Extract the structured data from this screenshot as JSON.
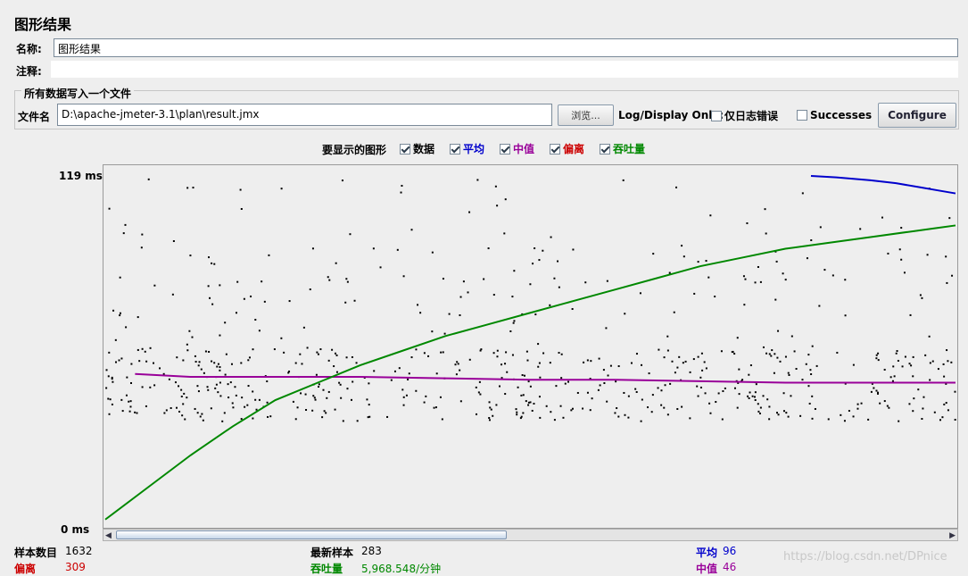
{
  "panel": {
    "title": "图形结果",
    "name_label": "名称:",
    "name_value": "图形结果",
    "comment_label": "注释:",
    "comment_value": ""
  },
  "file_group": {
    "legend": "所有数据写入一个文件",
    "file_label": "文件名",
    "file_value": "D:\\apache-jmeter-3.1\\plan\\result.jmx",
    "browse_button": "浏览...",
    "log_display_label": "Log/Display Only:",
    "errors_only_label": "仅日志错误",
    "successes_label": "Successes",
    "configure_button": "Configure"
  },
  "graph_options": {
    "label": "要显示的图形",
    "items": [
      {
        "label": "数据",
        "checked": true,
        "color": "#000000"
      },
      {
        "label": "平均",
        "checked": true,
        "color": "#0000cc"
      },
      {
        "label": "中值",
        "checked": true,
        "color": "#990099"
      },
      {
        "label": "偏离",
        "checked": true,
        "color": "#cc0000"
      },
      {
        "label": "吞吐量",
        "checked": true,
        "color": "#008800"
      }
    ]
  },
  "chart_data": {
    "type": "scatter",
    "y_max_label": "119 ms",
    "y_min_label": "0 ms",
    "ylim": [
      0,
      119
    ],
    "series": [
      {
        "name": "平均",
        "color": "#0000cc",
        "values": [
          [
            0.83,
            119
          ],
          [
            0.86,
            118.5
          ],
          [
            0.9,
            117.5
          ],
          [
            0.93,
            116.5
          ],
          [
            0.96,
            115
          ],
          [
            0.98,
            114
          ],
          [
            1.0,
            113
          ]
        ]
      },
      {
        "name": "中值",
        "color": "#990099",
        "values": [
          [
            0.035,
            51
          ],
          [
            0.1,
            50
          ],
          [
            0.2,
            50
          ],
          [
            0.3,
            50
          ],
          [
            0.4,
            49.5
          ],
          [
            0.5,
            49
          ],
          [
            0.6,
            49
          ],
          [
            0.7,
            48.5
          ],
          [
            0.8,
            48
          ],
          [
            0.9,
            48
          ],
          [
            1.0,
            48
          ]
        ]
      },
      {
        "name": "吞吐量",
        "color": "#008800",
        "values": [
          [
            0.0,
            1
          ],
          [
            0.05,
            12
          ],
          [
            0.1,
            23
          ],
          [
            0.15,
            33
          ],
          [
            0.2,
            42
          ],
          [
            0.25,
            48
          ],
          [
            0.3,
            54
          ],
          [
            0.35,
            59
          ],
          [
            0.4,
            64
          ],
          [
            0.45,
            68
          ],
          [
            0.5,
            72
          ],
          [
            0.55,
            76
          ],
          [
            0.6,
            80
          ],
          [
            0.65,
            84
          ],
          [
            0.7,
            88
          ],
          [
            0.75,
            91
          ],
          [
            0.8,
            94
          ],
          [
            0.85,
            96
          ],
          [
            0.9,
            98
          ],
          [
            0.95,
            100
          ],
          [
            1.0,
            102
          ]
        ]
      }
    ]
  },
  "scrollbar": {
    "thumb_start": 0.0,
    "thumb_end": 0.47
  },
  "stats": {
    "samples_label": "样本数目",
    "samples_value": "1632",
    "latest_label": "最新样本",
    "latest_value": "283",
    "average_label": "平均",
    "average_value": "96",
    "deviation_label": "偏离",
    "deviation_value": "309",
    "throughput_label": "吞吐量",
    "throughput_value": "5,968.548/分钟",
    "median_label": "中值",
    "median_value": "46"
  },
  "watermark": "https://blog.csdn.net/DPnice"
}
